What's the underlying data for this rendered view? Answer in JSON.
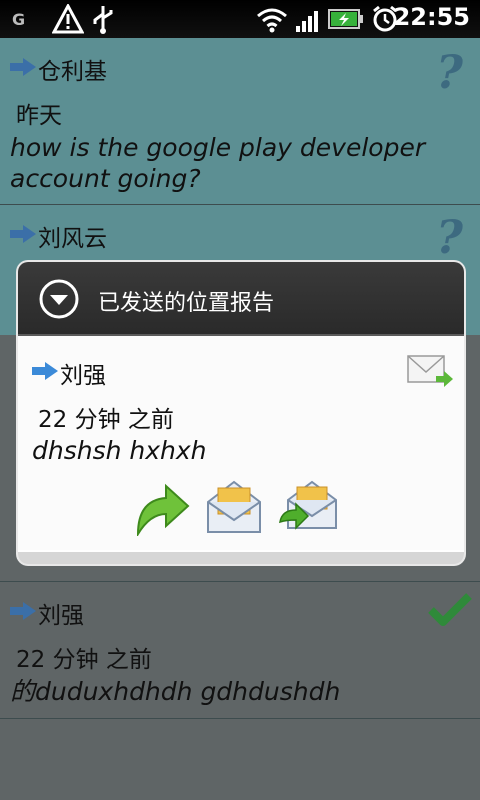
{
  "status_bar": {
    "time": "22:55",
    "icons": [
      "g-icon",
      "warning-icon",
      "usb-icon",
      "wifi-icon",
      "signal-icon",
      "battery-charging-icon",
      "alarm-icon"
    ]
  },
  "messages": [
    {
      "sender": "仓利基",
      "time": "昨天",
      "text": "how is the google play developer account going?",
      "status": "unknown"
    },
    {
      "sender": "刘风云",
      "time": "",
      "text": "",
      "status": "unknown"
    },
    {
      "sender": "刘强",
      "time": "22 分钟 之前",
      "text": "的duduxhdhdh gdhdushdh",
      "status": "delivered"
    }
  ],
  "popup": {
    "title": "已发送的位置报告",
    "sender": "刘强",
    "time": "22 分钟 之前",
    "text": "dhshsh hxhxh",
    "actions": [
      "reply-icon",
      "read-mail-icon",
      "forward-mail-icon"
    ]
  },
  "colors": {
    "row_highlight": "#5c8f93",
    "row_default": "#5f6566",
    "popup_header": "#333333"
  }
}
